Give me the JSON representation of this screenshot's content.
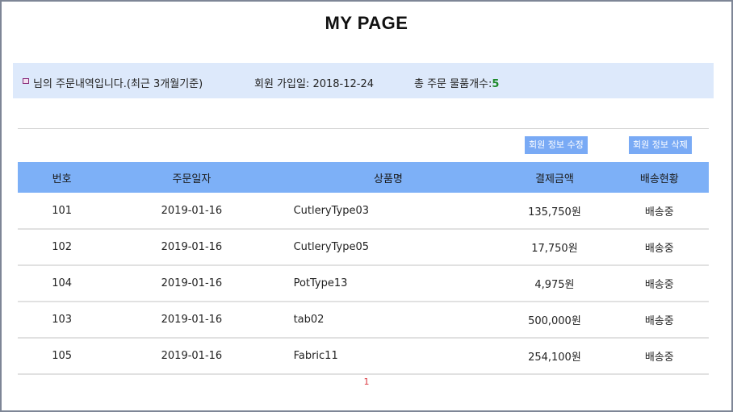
{
  "page": {
    "title": "MY PAGE"
  },
  "info_bar": {
    "order_notice": "님의 주문내역입니다.(최근 3개월기준)",
    "join_date_label": "회원 가입일: 2018-12-24",
    "total_items_label": "총 주문 물품개수:",
    "total_items_count": "5"
  },
  "actions": {
    "edit_label": "회원 정보 수정",
    "delete_label": "회원 정보 삭제"
  },
  "table": {
    "headers": [
      "번호",
      "주문일자",
      "상품명",
      "결제금액",
      "배송현황"
    ],
    "rows": [
      {
        "no": "101",
        "date": "2019-01-16",
        "product": "CutleryType03",
        "amount": "135,750원",
        "status": "배송중"
      },
      {
        "no": "102",
        "date": "2019-01-16",
        "product": "CutleryType05",
        "amount": "17,750원",
        "status": "배송중"
      },
      {
        "no": "104",
        "date": "2019-01-16",
        "product": "PotType13",
        "amount": "4,975원",
        "status": "배송중"
      },
      {
        "no": "103",
        "date": "2019-01-16",
        "product": "tab02",
        "amount": "500,000원",
        "status": "배송중"
      },
      {
        "no": "105",
        "date": "2019-01-16",
        "product": "Fabric11",
        "amount": "254,100원",
        "status": "배송중"
      }
    ]
  },
  "pagination": {
    "current": "1"
  },
  "colors": {
    "header_bg": "#7db0f7",
    "info_bg": "#dde9fb",
    "button_bg": "#79aaf5",
    "count_green": "#1d8a2a",
    "pager_red": "#d9363e"
  }
}
